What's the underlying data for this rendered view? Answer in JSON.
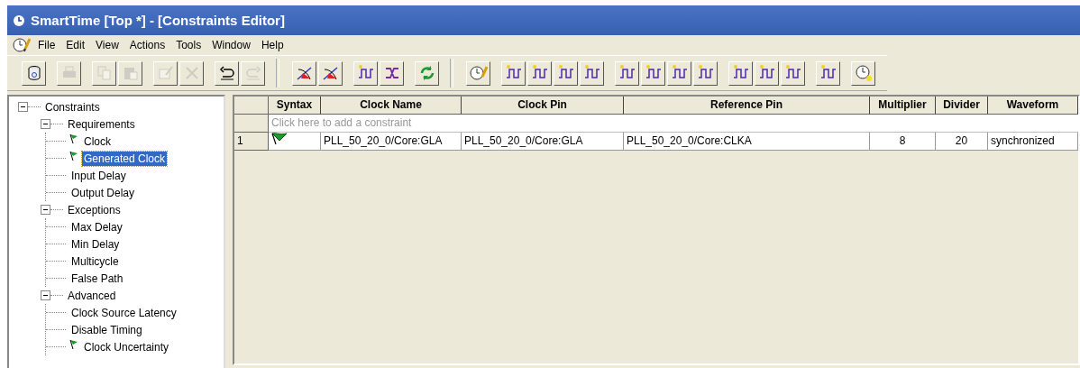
{
  "window": {
    "title": "SmartTime [Top *] - [Constraints Editor]"
  },
  "menu": [
    "File",
    "Edit",
    "View",
    "Actions",
    "Tools",
    "Window",
    "Help"
  ],
  "toolbar": [
    [
      {
        "disabled": false
      }
    ],
    [
      {
        "disabled": true
      }
    ],
    [
      {
        "disabled": true
      },
      {
        "disabled": true
      }
    ],
    [
      {
        "disabled": true
      },
      {
        "disabled": true
      }
    ],
    [
      {
        "disabled": false
      },
      {
        "disabled": true
      }
    ],
    [
      {
        "disabled": false
      },
      {
        "disabled": false
      }
    ],
    [
      {
        "disabled": false
      },
      {
        "disabled": false
      }
    ],
    [
      {
        "disabled": false
      }
    ],
    [
      {
        "disabled": false
      }
    ],
    [
      {
        "disabled": false
      },
      {
        "disabled": false
      },
      {
        "disabled": false
      },
      {
        "disabled": false
      }
    ],
    [
      {
        "disabled": false
      },
      {
        "disabled": false
      },
      {
        "disabled": false
      },
      {
        "disabled": false
      }
    ],
    [
      {
        "disabled": false
      },
      {
        "disabled": false
      },
      {
        "disabled": false
      }
    ],
    [
      {
        "disabled": false
      }
    ],
    [
      {
        "disabled": false
      }
    ]
  ],
  "tree": [
    {
      "label": "Constraints",
      "expanded": true,
      "children": [
        {
          "label": "Requirements",
          "expanded": true,
          "children": [
            {
              "label": "Clock",
              "flag": true,
              "selected": false
            },
            {
              "label": "Generated Clock",
              "flag": true,
              "selected": true
            },
            {
              "label": "Input Delay",
              "flag": false,
              "selected": false
            },
            {
              "label": "Output Delay",
              "flag": false,
              "selected": false
            }
          ]
        },
        {
          "label": "Exceptions",
          "expanded": true,
          "children": [
            {
              "label": "Max Delay",
              "flag": false,
              "selected": false
            },
            {
              "label": "Min Delay",
              "flag": false,
              "selected": false
            },
            {
              "label": "Multicycle",
              "flag": false,
              "selected": false
            },
            {
              "label": "False Path",
              "flag": false,
              "selected": false
            }
          ]
        },
        {
          "label": "Advanced",
          "expanded": true,
          "children": [
            {
              "label": "Clock Source Latency",
              "flag": false,
              "selected": false
            },
            {
              "label": "Disable Timing",
              "flag": false,
              "selected": false
            },
            {
              "label": "Clock Uncertainty",
              "flag": true,
              "selected": false
            }
          ]
        }
      ]
    }
  ],
  "table": {
    "columns": [
      "",
      "Syntax",
      "Clock Name",
      "Clock Pin",
      "Reference Pin",
      "Multiplier",
      "Divider",
      "Waveform"
    ],
    "new_row_placeholder": "Click here to add a constraint",
    "rows": [
      {
        "syntax_ok": true,
        "cells": [
          "1",
          "",
          "PLL_50_20_0/Core:GLA",
          "PLL_50_20_0/Core:GLA",
          "PLL_50_20_0/Core:CLKA",
          "8",
          "20",
          "synchronized"
        ]
      }
    ]
  }
}
